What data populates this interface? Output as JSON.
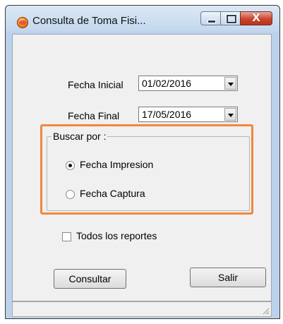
{
  "window": {
    "title": "Consulta de Toma Fisi...",
    "icon": "app-icon",
    "controls": {
      "minimize": "minimize-icon",
      "maximize": "maximize-icon",
      "close": "X"
    }
  },
  "form": {
    "fecha_inicial": {
      "label": "Fecha Inicial",
      "value": "01/02/2016"
    },
    "fecha_final": {
      "label": "Fecha Final",
      "value": "17/05/2016"
    },
    "buscar_por": {
      "legend": "Buscar por :",
      "options": [
        {
          "label": "Fecha Impresion",
          "selected": true
        },
        {
          "label": "Fecha Captura",
          "selected": false
        }
      ]
    },
    "todos_reportes": {
      "label": "Todos los reportes",
      "checked": false
    }
  },
  "buttons": {
    "consultar": "Consultar",
    "salir": "Salir"
  },
  "colors": {
    "highlight": "#f0873c",
    "window_frame": "#c4d8ee",
    "client_bg": "#f0f0f0"
  }
}
